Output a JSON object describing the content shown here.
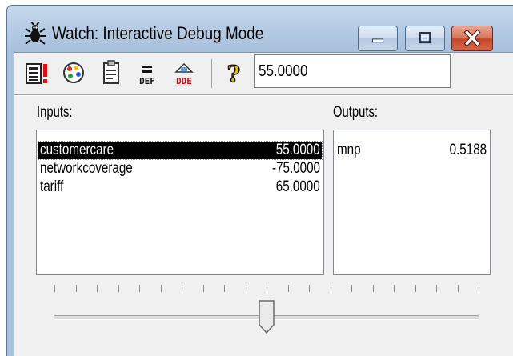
{
  "window": {
    "title": "Watch: Interactive Debug Mode",
    "title_icon": "bug-icon"
  },
  "toolbar": {
    "icons": [
      "exclamation-report-icon",
      "palette-icon",
      "clipboard-icon",
      "def-icon",
      "dde-icon",
      "help-icon"
    ],
    "def_label": "DEF",
    "dde_label": "DDE",
    "value": "55.0000"
  },
  "inputs": {
    "label": "Inputs:",
    "rows": [
      {
        "name": "customercare",
        "value": "55.0000",
        "selected": true
      },
      {
        "name": "networkcoverage",
        "value": "-75.0000",
        "selected": false
      },
      {
        "name": "tariff",
        "value": "65.0000",
        "selected": false
      }
    ]
  },
  "outputs": {
    "label": "Outputs:",
    "rows": [
      {
        "name": "mnp",
        "value": "0.5188"
      }
    ]
  },
  "slider": {
    "position_fraction": 0.5
  },
  "colors": {
    "frame": "#a9c1dc",
    "client": "#f0f0f0",
    "selection": "#000000",
    "close_button": "#c4452a"
  }
}
